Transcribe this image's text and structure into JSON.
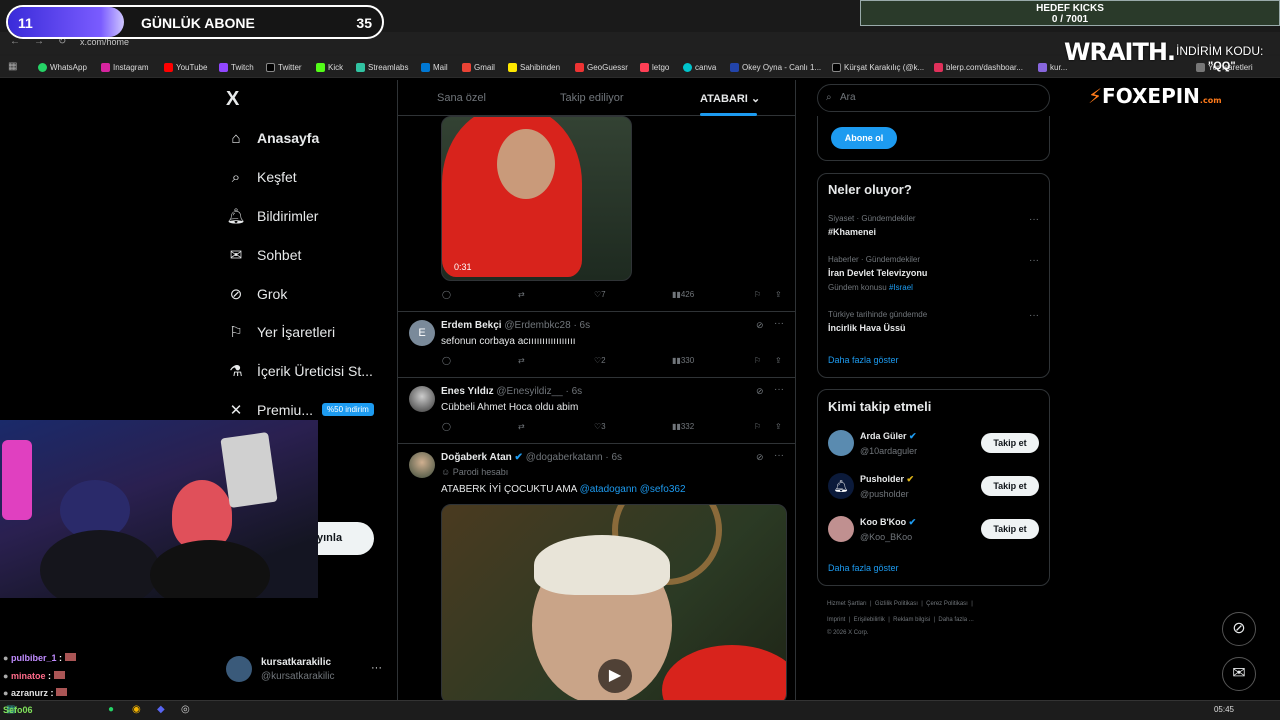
{
  "browser": {
    "url": "x.com/home",
    "bookmarks": [
      "WhatsApp",
      "Instagram",
      "YouTube",
      "Twitch",
      "Twitter",
      "Kick",
      "Streamlabs",
      "Mail",
      "Gmail",
      "Sahibinden",
      "GeoGuessr",
      "letgo",
      "canva",
      "Okey Oyna - Canlı 1...",
      "Kürşat Karakılıç (@k...",
      "blerp.com/dashboar...",
      "kur..."
    ],
    "bookmarks_more": "Yer İşaretleri"
  },
  "overlay": {
    "sub_current": "11",
    "sub_title": "GÜNLÜK ABONE",
    "sub_target": "35",
    "sub_progress": 0.31,
    "kicks_title": "HEDEF KICKS",
    "kicks_value": "0 / 7001",
    "wraith": "WRAITH.",
    "indirim": "İNDİRİM KODU:",
    "qq": "\"QQ\"",
    "foxepin_a": "FOX",
    "foxepin_b": "EPIN",
    "foxepin_com": ".com"
  },
  "nav": {
    "logo": "X",
    "items": [
      "Anasayfa",
      "Keşfet",
      "Bildirimler",
      "Sohbet",
      "Grok",
      "Yer İşaretleri",
      "İçerik Üreticisi St...",
      "Premiu..."
    ],
    "premium_badge": "%50 indirim",
    "post_button": "yınla",
    "account_name": "kursatkarakilic",
    "account_handle": "@kursatkarakilic",
    "hidden_label": "a"
  },
  "feed": {
    "tabs": [
      "Sana özel",
      "Takip ediliyor",
      "ATABARI"
    ],
    "tweets": [
      {
        "video_time": "0:31",
        "replies": "",
        "reposts": "",
        "likes": "7",
        "views": "426"
      },
      {
        "name": "Erdem Bekçi",
        "handle": "@Erdembkc28 · 6s",
        "text": "sefonun corbaya acııııııııııııııııı",
        "likes": "2",
        "views": "330",
        "avatar_letter": "E"
      },
      {
        "name": "Enes Yıldız",
        "handle": "@Enesyildiz__ · 6s",
        "text": "Cübbeli Ahmet Hoca oldu abim",
        "likes": "3",
        "views": "332"
      },
      {
        "name": "Doğaberk Atan",
        "handle": "@dogaberkatann · 6s",
        "parody": "Parodi hesabı",
        "text": "ATABERK İYİ ÇOCUKTU AMA",
        "mentions": "@atadogann @sefo362"
      }
    ]
  },
  "right": {
    "search_placeholder": "Ara",
    "subscribe": "Abone ol",
    "trends_title": "Neler oluyor?",
    "trends": [
      {
        "meta": "Siyaset · Gündemdekiler",
        "name": "#Khamenei"
      },
      {
        "meta": "Haberler · Gündemdekiler",
        "name": "İran Devlet Televizyonu",
        "extra": "Gündem konusu",
        "extra_tag": "#Israel"
      },
      {
        "meta": "Türkiye tarihinde gündemde",
        "name": "İncirlik Hava Üssü"
      }
    ],
    "show_more": "Daha fazla göster",
    "who_title": "Kimi takip etmeli",
    "who": [
      {
        "name": "Arda Güler",
        "handle": "@10ardaguler",
        "color": "#5a8bb0"
      },
      {
        "name": "Pusholder",
        "handle": "@pusholder",
        "color": "#0b1a3a"
      },
      {
        "name": "Koo B'Koo",
        "handle": "@Koo_BKoo",
        "color": "#c09090"
      }
    ],
    "follow_label": "Takip et",
    "footer1": [
      "Hizmet Şartları",
      "Gizlilik Politikası",
      "Çerez Politikası"
    ],
    "footer2": [
      "Imprint",
      "Erişilebilirlik",
      "Reklam bilgisi",
      "Daha fazla ..."
    ],
    "copyright": "© 2026 X Corp."
  },
  "chat": [
    {
      "user": "pulbiber_1",
      "color": "#c08cff"
    },
    {
      "user": "minatoe",
      "color": "#ff6b8a"
    },
    {
      "user": "azranurz",
      "color": "#e0e0e0"
    },
    {
      "user": "Sefo06",
      "color": "#7fe05a"
    }
  ],
  "taskbar": {
    "clock": "05:45"
  }
}
